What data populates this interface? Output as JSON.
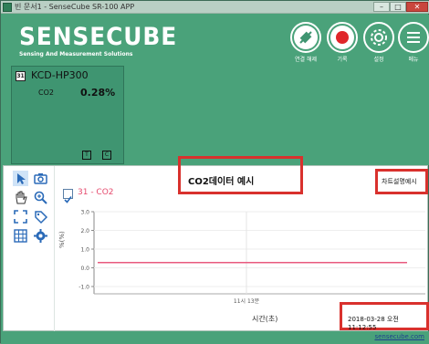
{
  "window": {
    "title": "빈 문서1 - SenseCube SR-100 APP",
    "min": "–",
    "max": "□",
    "close": "✕"
  },
  "header": {
    "logo": "SENSECUBE",
    "subtitle": "Sensing And Measurement Solutions",
    "buttons": [
      {
        "label": "연결 해제",
        "icon": "plug-icon"
      },
      {
        "label": "기록",
        "icon": "record-icon"
      },
      {
        "label": "설정",
        "icon": "gear-icon"
      },
      {
        "label": "메뉴",
        "icon": "menu-icon"
      }
    ]
  },
  "device": {
    "number": "31",
    "name": "KCD-HP300",
    "sensor": "CO2",
    "value": "0.28%",
    "btn_t": "T",
    "btn_c": "C"
  },
  "chart": {
    "title": "CO2데이터 예시",
    "note": "차트설명예시",
    "series_label": "31 - CO2",
    "time_label": "시간(초)",
    "date_label": "2018-03-28 오전 11:12:55"
  },
  "chart_data": {
    "type": "line",
    "title": "CO2데이터 예시",
    "xlabel": "시간(초)",
    "ylabel": "%(%)",
    "x_ticks": [
      "11시 13분"
    ],
    "y_ticks": [
      "3.0",
      "2.0",
      "1.0",
      "0.0",
      "-1.0"
    ],
    "ylim": [
      -1.0,
      3.0
    ],
    "series": [
      {
        "name": "31 - CO2",
        "color": "#e85a7e",
        "values": [
          0.28,
          0.28
        ]
      }
    ],
    "grid": true
  },
  "footer": {
    "site": "sensecube.com"
  },
  "colors": {
    "accent": "#4aa27a",
    "highlight": "#d9312d",
    "series": "#e85a7e"
  }
}
